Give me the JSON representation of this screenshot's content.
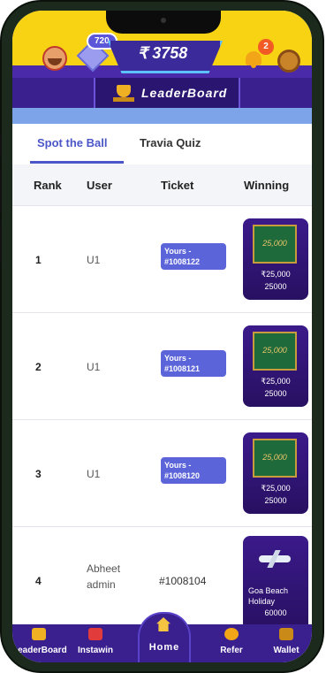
{
  "topbar": {
    "coins": "720",
    "wallet_amount": "₹ 3758",
    "notification_count": "2"
  },
  "header": {
    "title": "LeaderBoard"
  },
  "tabs": [
    {
      "label": "Spot the Ball",
      "active": true
    },
    {
      "label": "Travia Quiz",
      "active": false
    }
  ],
  "table": {
    "columns": [
      "Rank",
      "User",
      "Ticket",
      "Winning"
    ],
    "rows": [
      {
        "rank": "1",
        "user": "U1",
        "ticket": "Yours - #1008122",
        "prize_image_text": "25,000",
        "prize_name": "₹25,000",
        "prize_value": "25000"
      },
      {
        "rank": "2",
        "user": "U1",
        "ticket": "Yours - #1008121",
        "prize_image_text": "25,000",
        "prize_name": "₹25,000",
        "prize_value": "25000"
      },
      {
        "rank": "3",
        "user": "U1",
        "ticket": "Yours - #1008120",
        "prize_image_text": "25,000",
        "prize_name": "₹25,000",
        "prize_value": "25000"
      },
      {
        "rank": "4",
        "user_line1": "Abheet",
        "user_line2": "admin",
        "ticket": "#1008104",
        "prize_name": "Goa Beach Holiday",
        "prize_value": "60000"
      }
    ]
  },
  "bottom_nav": [
    {
      "label": "LeaderBoard",
      "icon": "trophy-icon"
    },
    {
      "label": "Instawin",
      "icon": "gift-icon"
    },
    {
      "label": "Home",
      "icon": "home-icon"
    },
    {
      "label": "Refer",
      "icon": "medal-icon"
    },
    {
      "label": "Wallet",
      "icon": "wallet-icon"
    }
  ]
}
